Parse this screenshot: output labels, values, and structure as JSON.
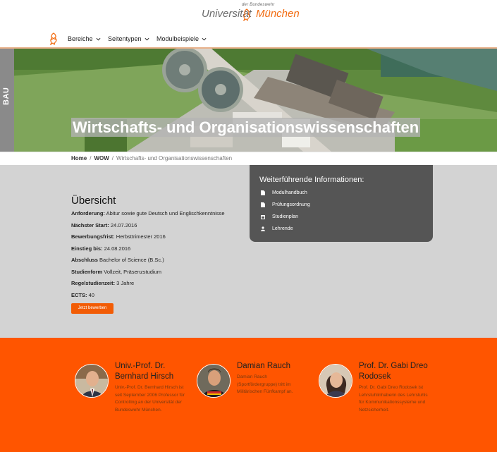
{
  "header": {
    "logo_sup": "der Bundeswehr",
    "logo_left": "Universität",
    "logo_right": "München"
  },
  "nav": {
    "items": [
      {
        "label": "Bereiche"
      },
      {
        "label": "Seitentypen"
      },
      {
        "label": "Modulbeispiele"
      }
    ]
  },
  "hero": {
    "side_tab": "BAU",
    "title": "Wirtschafts- und Organisationswissenschaften"
  },
  "breadcrumb": {
    "home": "Home",
    "sep1": "/",
    "wow": "WOW",
    "sep2": "/",
    "current": "Wirtschafts- und Organisationswissenschaften"
  },
  "overview": {
    "title": "Übersicht",
    "rows": [
      {
        "label": "Anforderung:",
        "value": " Abitur sowie gute Deutsch und Englischkenntnisse"
      },
      {
        "label": "Nächster Start:",
        "value": " 24.07.2016"
      },
      {
        "label": "Bewerbungsfrist:",
        "value": " Herbsttrimester 2016"
      },
      {
        "label": "Einstieg bis:",
        "value": " 24.08.2016"
      },
      {
        "label": "Abschluss",
        "value": " Bachelor of Science (B.Sc.)"
      },
      {
        "label": "Studienform",
        "value": " Vollzeit, Präsenzstudium"
      },
      {
        "label": "Regelstudienzeit:",
        "value": " 3 Jahre"
      },
      {
        "label": "ECTS:",
        "value": " 40"
      }
    ],
    "apply_label": "Jetzt bewerben"
  },
  "info": {
    "title": "Weiterführende Informationen:",
    "items": [
      {
        "label": "Modulhandbuch",
        "icon": "document-icon"
      },
      {
        "label": "Prüfungsordnung",
        "icon": "document-icon"
      },
      {
        "label": "Studienplan",
        "icon": "calendar-icon"
      },
      {
        "label": "Lehrende",
        "icon": "person-icon"
      }
    ]
  },
  "people": [
    {
      "name": "Univ.-Prof. Dr. Bernhard Hirsch",
      "desc": "Univ.-Prof. Dr. Bernhard Hirsch ist seit September 2006 Professor für Controlling an der Universität der Bundeswehr München."
    },
    {
      "name": "Damian Rauch",
      "desc": "Damian Rauch (Sportfördergruppe) tritt im Militärischen Fünfkampf an."
    },
    {
      "name": "Prof. Dr. Gabi Dreo Rodosek",
      "desc": "Prof. Dr. Gabi Dreo Rodosek ist Lehrstuhlinhaberin des Lehrstuhls für Kommunikationssysteme und Netzsicherheit."
    }
  ],
  "colors": {
    "accent": "#ff5500",
    "info_bg": "#555555",
    "main_bg": "#d3d3d3"
  }
}
